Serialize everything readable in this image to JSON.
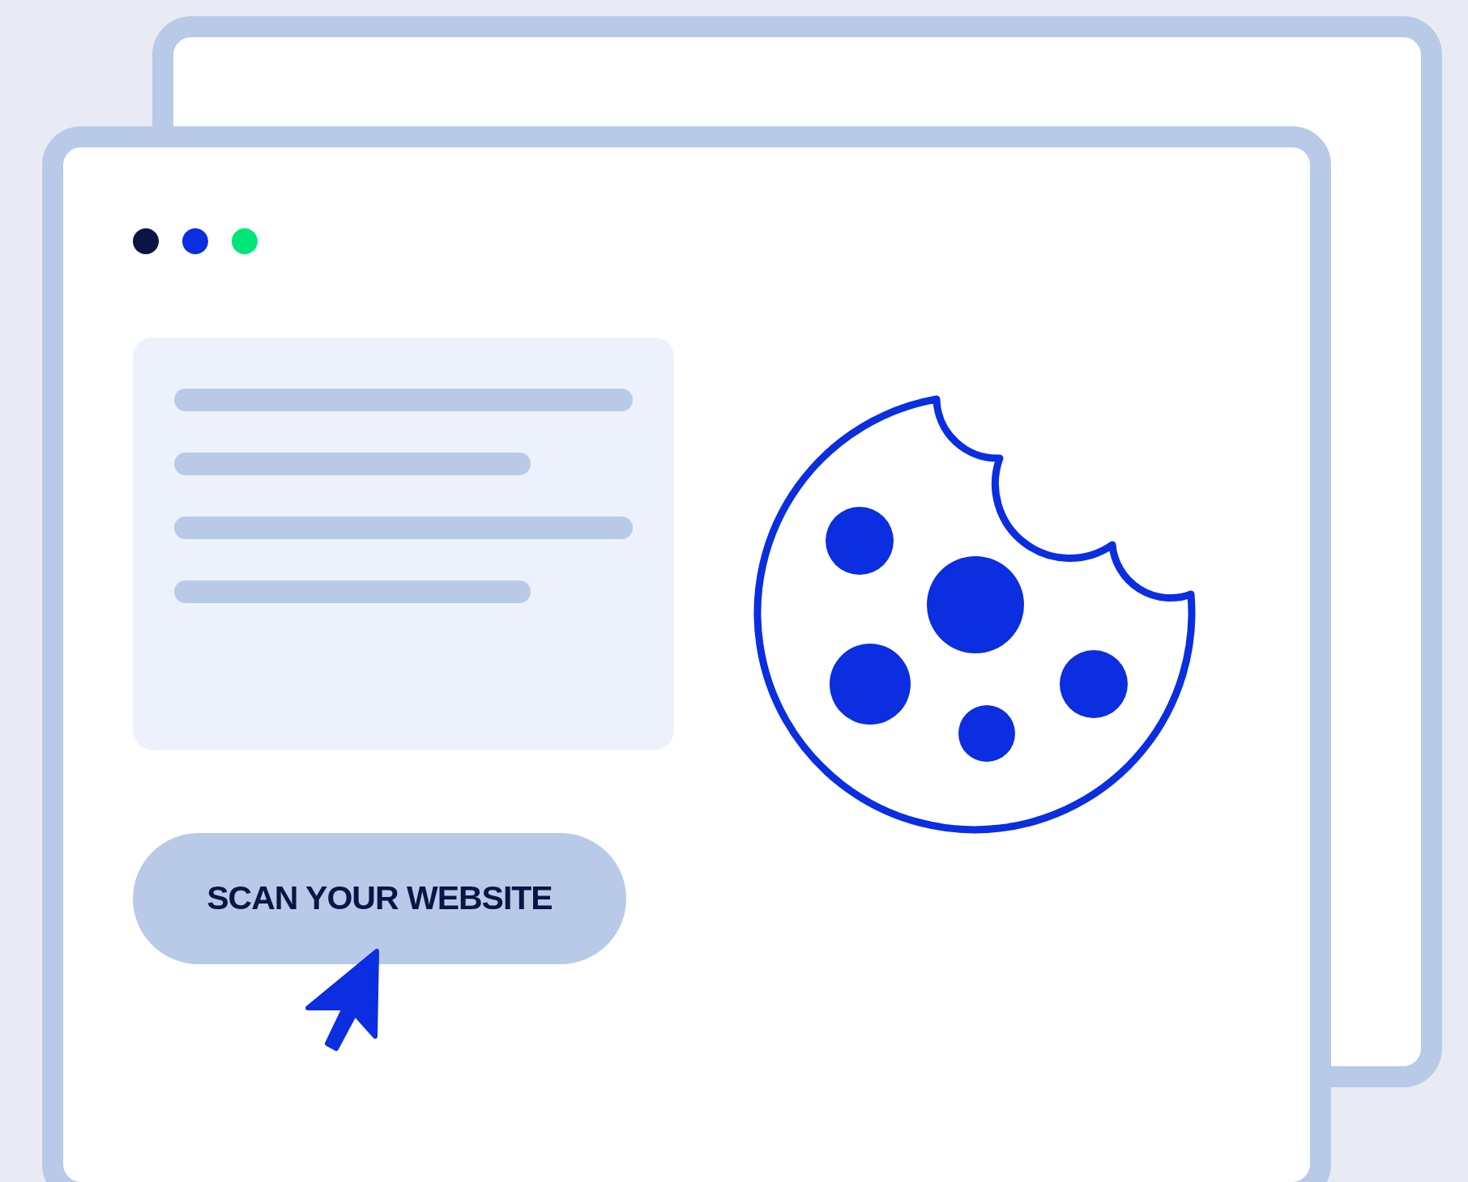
{
  "window_dots": [
    {
      "color": "#0b1545"
    },
    {
      "color": "#0a2ee0"
    },
    {
      "color": "#00e676"
    }
  ],
  "scan_button": {
    "label": "SCAN YOUR WEBSITE"
  }
}
